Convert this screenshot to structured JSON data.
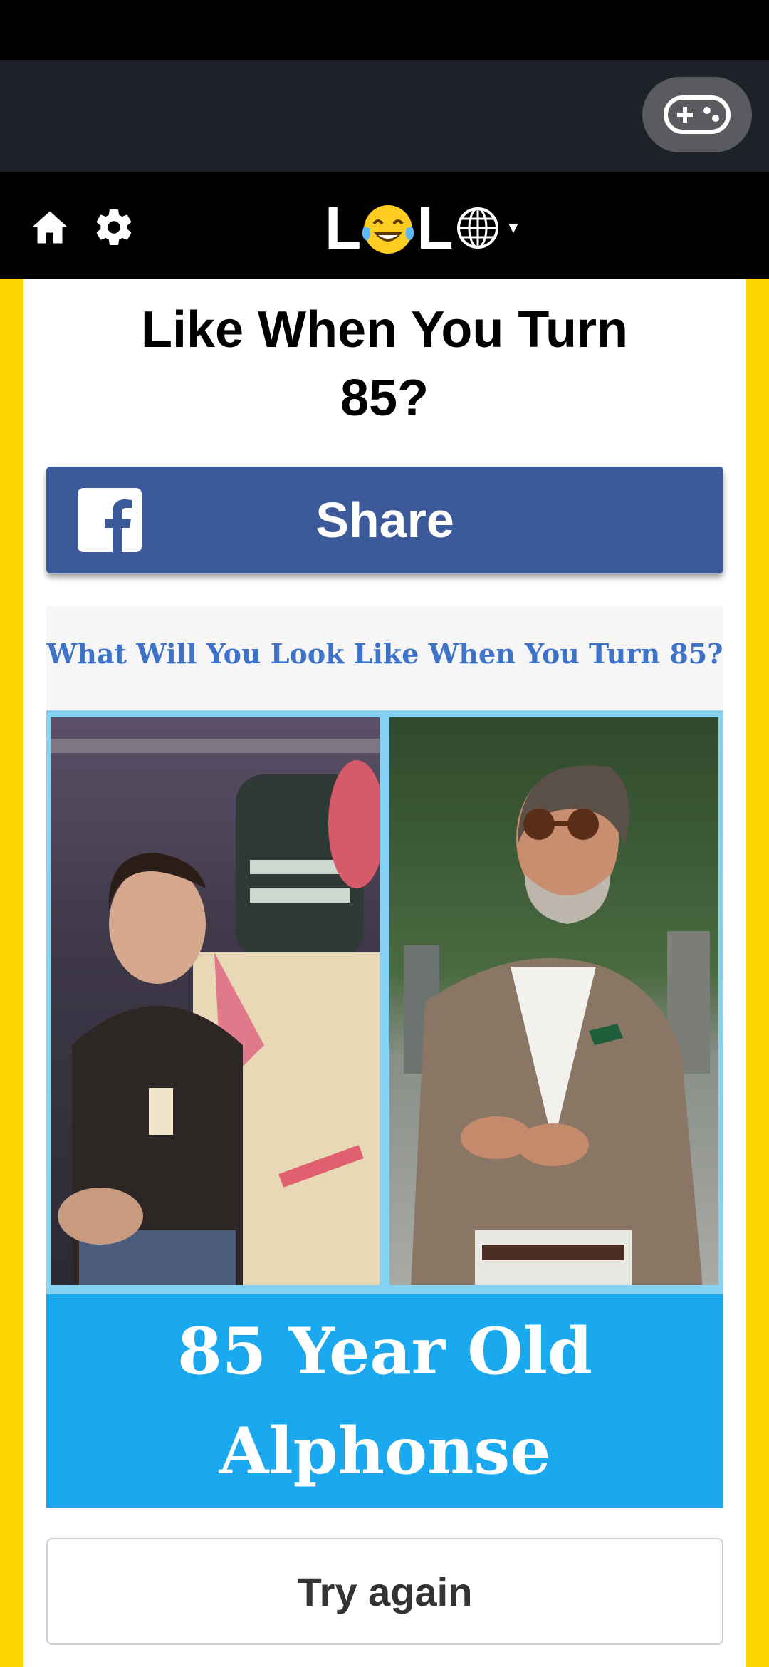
{
  "nav": {
    "logo_left": "L",
    "logo_right": "L"
  },
  "page": {
    "title": "Like When You Turn 85?"
  },
  "share": {
    "label": "Share"
  },
  "quiz": {
    "heading": "What Will You Look Like When You Turn 85?",
    "caption_line1": "85 Year Old",
    "caption_line2": "Alphonse"
  },
  "actions": {
    "try_again": "Try again"
  },
  "icons": {
    "game": "gamepad-icon",
    "home": "home-icon",
    "settings": "gear-icon",
    "logo_emoji": "laughing-tears-emoji",
    "language": "globe-icon",
    "facebook": "facebook-icon"
  },
  "colors": {
    "brand_yellow": "#ffd500",
    "facebook_blue": "#3c5a9a",
    "caption_blue": "#1aa9ee",
    "heading_blue": "#3f72c9"
  }
}
